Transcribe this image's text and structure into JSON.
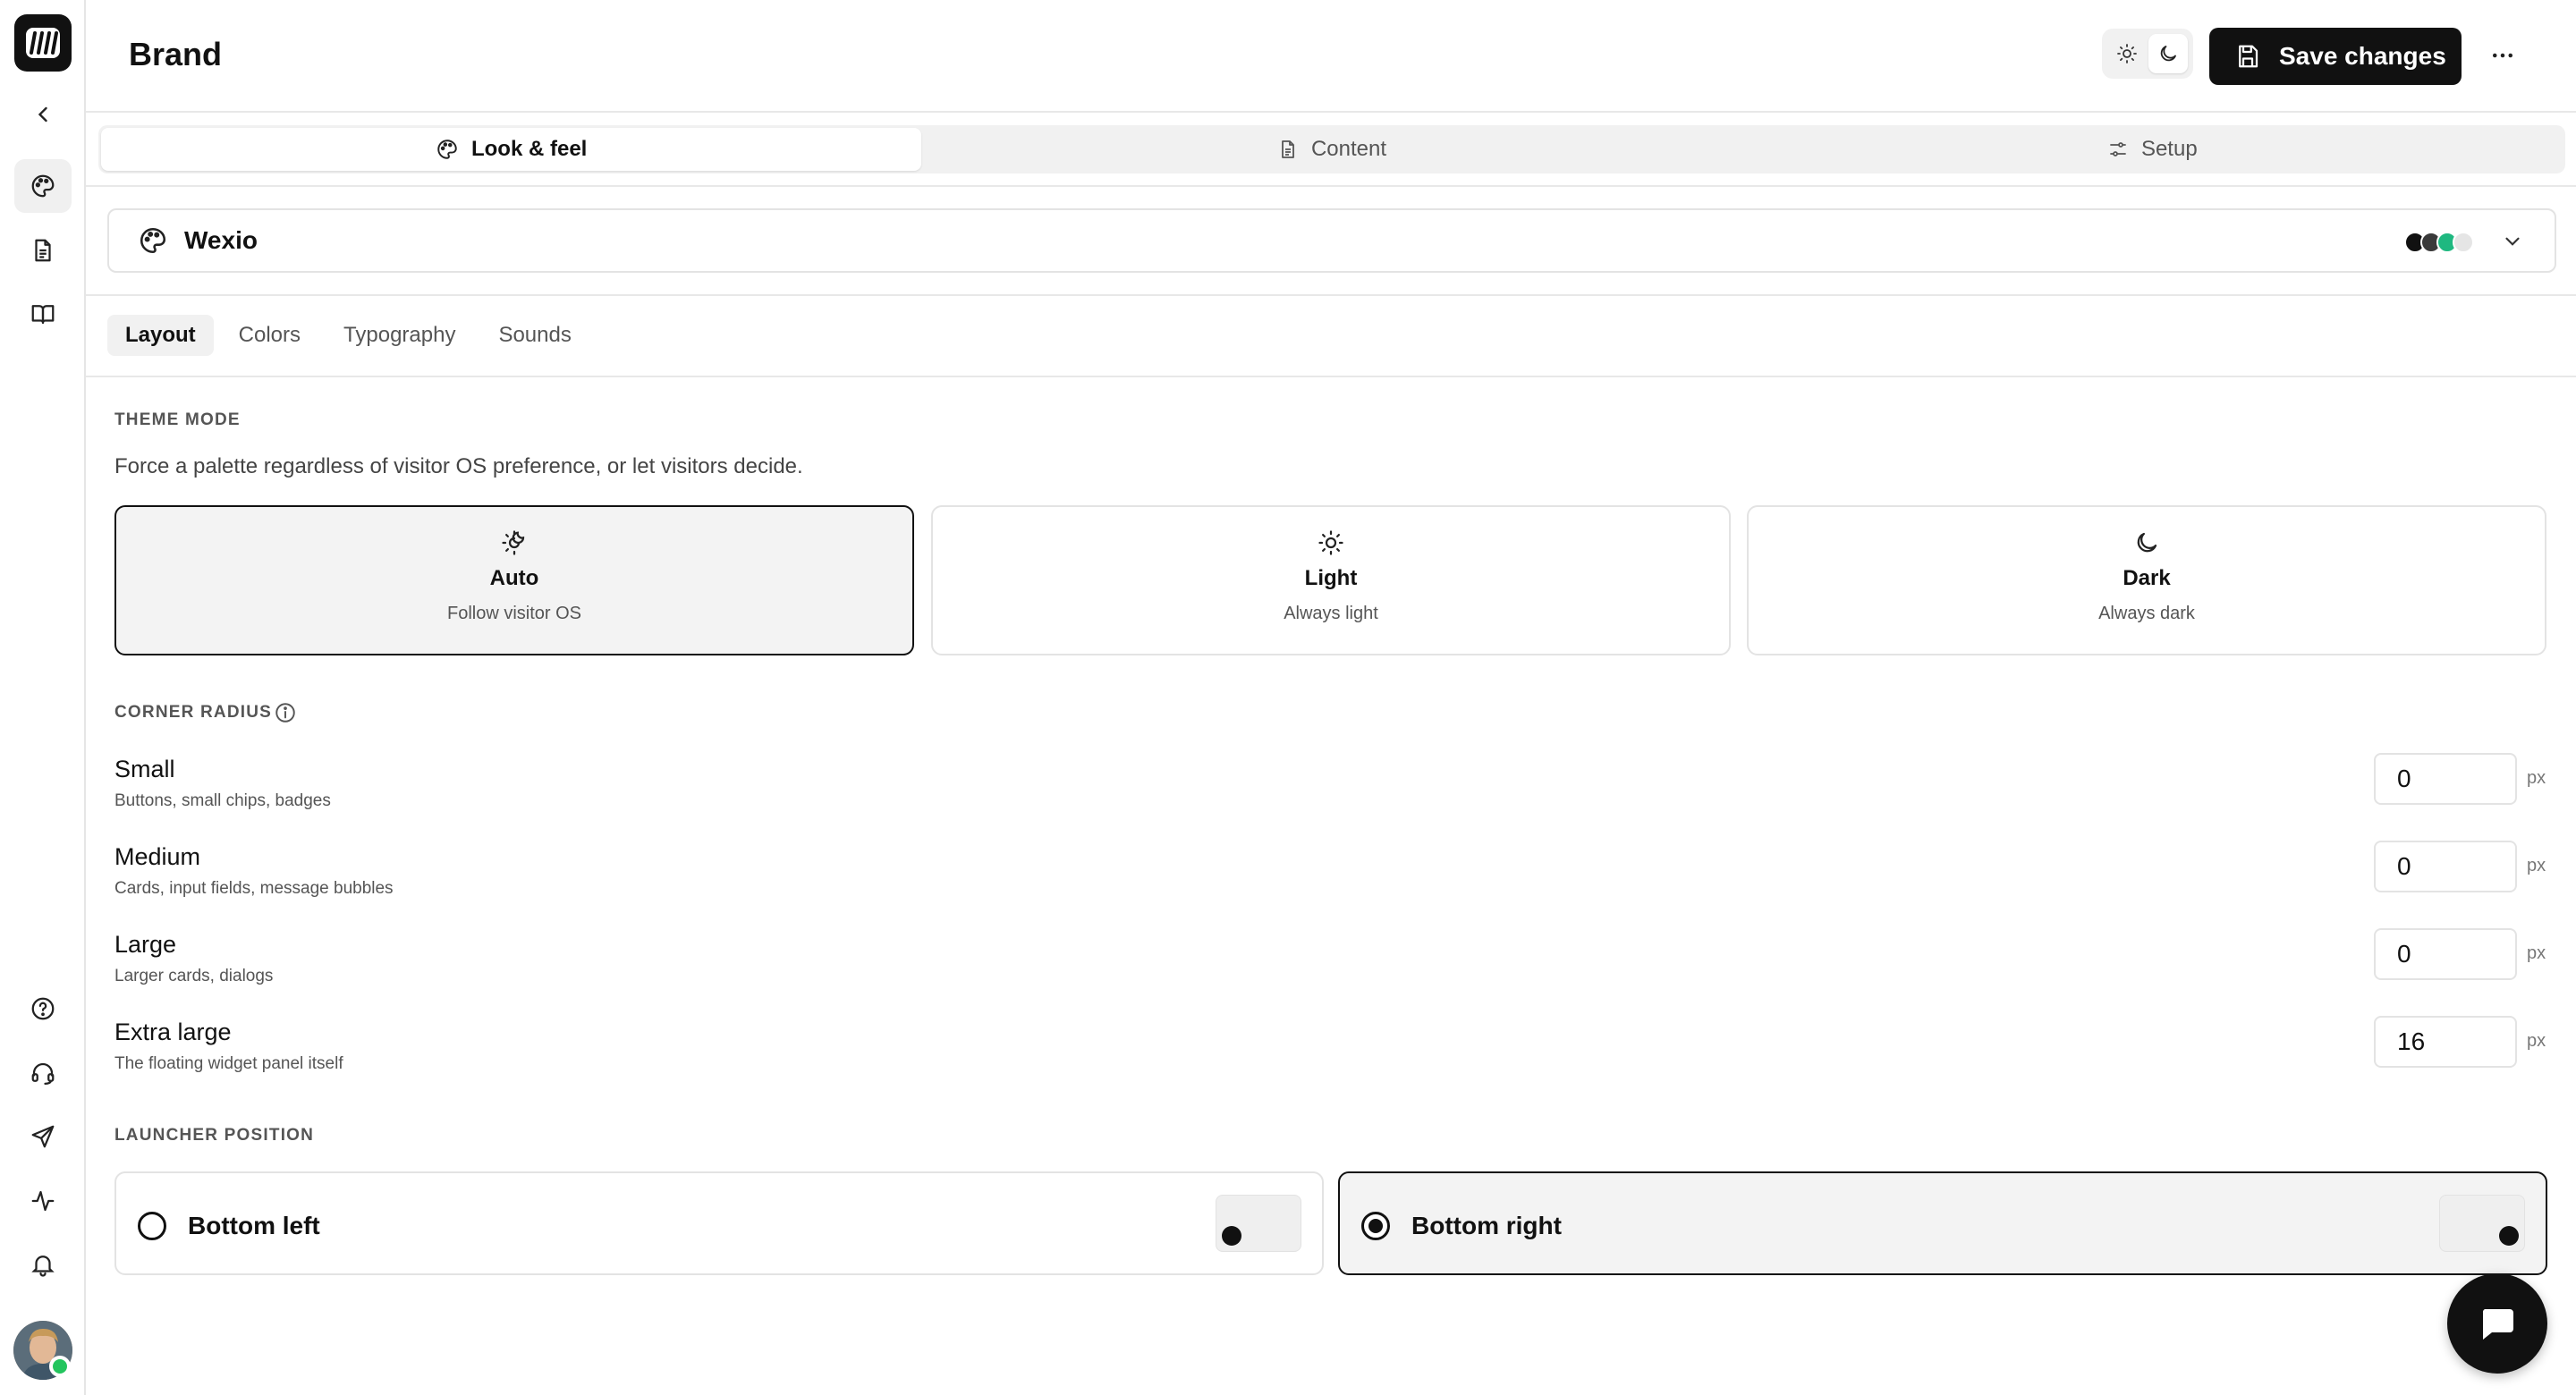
{
  "header": {
    "title": "Brand",
    "save_label": "Save changes"
  },
  "main_tabs": [
    {
      "label": "Look & feel",
      "icon": "palette-icon",
      "selected": true
    },
    {
      "label": "Content",
      "icon": "document-icon",
      "selected": false
    },
    {
      "label": "Setup",
      "icon": "sliders-icon",
      "selected": false
    }
  ],
  "brand": {
    "name": "Wexio",
    "swatch_colors": [
      "#111111",
      "#3a3a3a",
      "#1fb880",
      "#e5e5e5"
    ]
  },
  "sub_tabs": [
    {
      "label": "Layout",
      "selected": true
    },
    {
      "label": "Colors",
      "selected": false
    },
    {
      "label": "Typography",
      "selected": false
    },
    {
      "label": "Sounds",
      "selected": false
    }
  ],
  "theme_mode": {
    "title": "THEME MODE",
    "description": "Force a palette regardless of visitor OS preference, or let visitors decide.",
    "options": [
      {
        "title": "Auto",
        "subtitle": "Follow visitor OS",
        "icon": "sun-moon-icon",
        "selected": true
      },
      {
        "title": "Light",
        "subtitle": "Always light",
        "icon": "sun-icon",
        "selected": false
      },
      {
        "title": "Dark",
        "subtitle": "Always dark",
        "icon": "moon-icon",
        "selected": false
      }
    ]
  },
  "corner_radius": {
    "title": "CORNER RADIUS",
    "unit": "px",
    "rows": [
      {
        "label": "Small",
        "description": "Buttons, small chips, badges",
        "value": "0"
      },
      {
        "label": "Medium",
        "description": "Cards, input fields, message bubbles",
        "value": "0"
      },
      {
        "label": "Large",
        "description": "Larger cards, dialogs",
        "value": "0"
      },
      {
        "label": "Extra large",
        "description": "The floating widget panel itself",
        "value": "16"
      }
    ]
  },
  "launcher_position": {
    "title": "LAUNCHER POSITION",
    "options": [
      {
        "label": "Bottom left",
        "selected": false
      },
      {
        "label": "Bottom right",
        "selected": true
      }
    ]
  },
  "colors": {
    "accent": "#111111",
    "selected_bg": "#f3f3f3",
    "border": "#e3e3e3",
    "online": "#23c55e"
  }
}
